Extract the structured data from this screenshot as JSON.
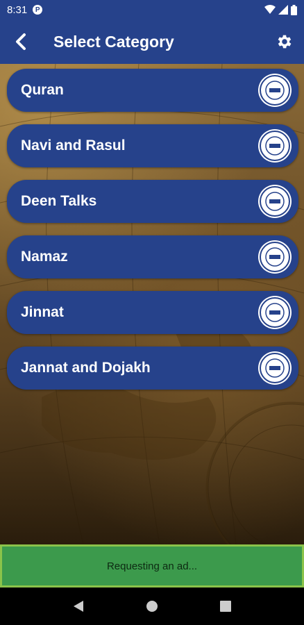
{
  "status_bar": {
    "time": "8:31",
    "notification_badge": "P"
  },
  "app_bar": {
    "title": "Select Category",
    "back_icon": "chevron-left-icon",
    "settings_icon": "gear-icon"
  },
  "categories": [
    {
      "label": "Quran"
    },
    {
      "label": "Navi and Rasul"
    },
    {
      "label": "Deen Talks"
    },
    {
      "label": "Namaz"
    },
    {
      "label": "Jinnat"
    },
    {
      "label": "Jannat and Dojakh"
    }
  ],
  "ad": {
    "text": "Requesting an ad..."
  },
  "colors": {
    "primary": "#26428b",
    "ad_background": "#3c9a4c",
    "ad_border": "#8bc34a"
  },
  "nav": {
    "back_icon": "triangle-back-icon",
    "home_icon": "circle-home-icon",
    "recents_icon": "square-recents-icon"
  }
}
